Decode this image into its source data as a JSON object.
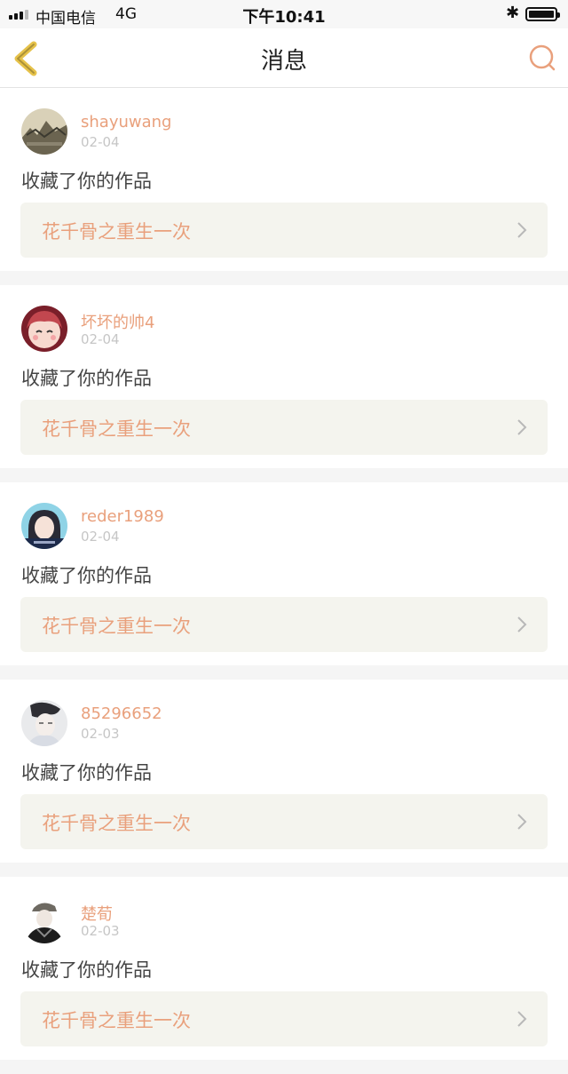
{
  "status_bar": {
    "carrier": "中国电信",
    "network": "4G",
    "time": "下午10:41"
  },
  "nav": {
    "title": "消息",
    "back_icon": "chevron-left-icon",
    "search_icon": "search-icon",
    "accent_color": "#e9a07c",
    "back_color": "#e6c24a"
  },
  "messages": [
    {
      "username": "shayuwang",
      "date": "02-04",
      "action": "收藏了你的作品",
      "work_title": "花千骨之重生一次"
    },
    {
      "username": "坏坏的帅4",
      "date": "02-04",
      "action": "收藏了你的作品",
      "work_title": "花千骨之重生一次"
    },
    {
      "username": "reder1989",
      "date": "02-04",
      "action": "收藏了你的作品",
      "work_title": "花千骨之重生一次"
    },
    {
      "username": "85296652",
      "date": "02-03",
      "action": "收藏了你的作品",
      "work_title": "花千骨之重生一次"
    },
    {
      "username": "楚荀",
      "date": "02-03",
      "action": "收藏了你的作品",
      "work_title": "花千骨之重生一次"
    }
  ]
}
